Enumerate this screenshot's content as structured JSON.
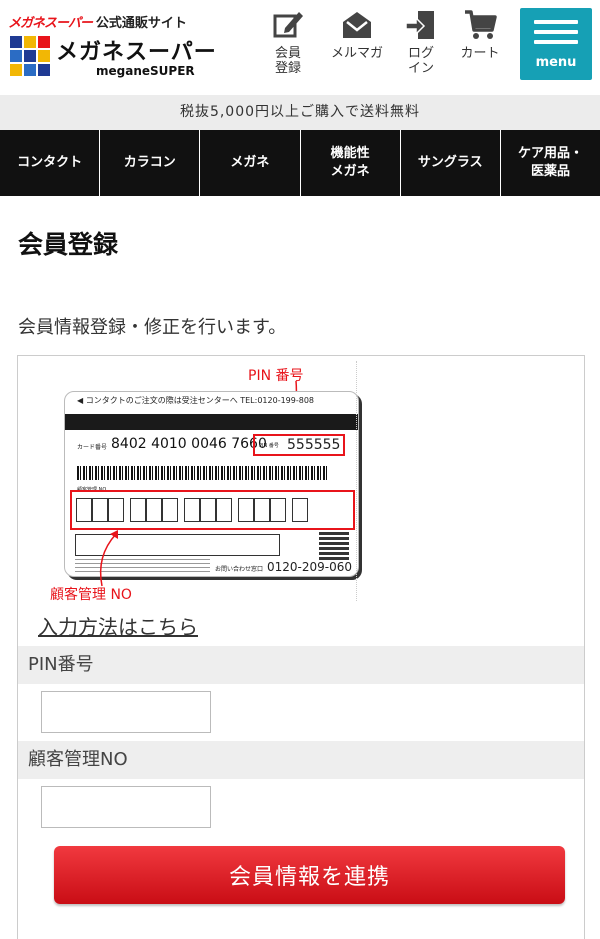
{
  "header": {
    "logo_brand": "メガネスーパー",
    "logo_catch": "公式通販サイト",
    "logo_name": "メガネスーパー",
    "logo_sub": "meganeSUPER",
    "nav": [
      {
        "label": "会員\n登録",
        "label1": "会員",
        "label2": "登録",
        "icon": "edit-icon"
      },
      {
        "label": "メルマガ",
        "icon": "mail-icon"
      },
      {
        "label1": "ログ",
        "label2": "イン",
        "icon": "login-icon"
      },
      {
        "label": "カート",
        "icon": "cart-icon"
      }
    ],
    "menu_label": "menu"
  },
  "shipping_notice": "税抜5,000円以上ご購入で送料無料",
  "categories": [
    {
      "label1": "コンタクト",
      "label2": ""
    },
    {
      "label1": "カラコン",
      "label2": ""
    },
    {
      "label1": "メガネ",
      "label2": ""
    },
    {
      "label1": "機能性",
      "label2": "メガネ"
    },
    {
      "label1": "サングラス",
      "label2": ""
    },
    {
      "label1": "ケア用品・",
      "label2": "医薬品"
    }
  ],
  "page": {
    "title": "会員登録",
    "intro": "会員情報登録・修正を行います。"
  },
  "card_image": {
    "pin_callout": "PIN 番号",
    "customer_no_callout": "顧客管理 NO",
    "top_text": "◀  コンタクトのご注文の際は受注センターへ TEL:0120-199-808",
    "card_number_label": "カード番号",
    "card_number": "8402 4010 0046 7660",
    "pin_small_label": "PIN 番号",
    "pin_value": "555555",
    "customer_no_label": "顧客管理 NO",
    "tel_label": "お問い合わせ窓口",
    "tel": "0120-209-060"
  },
  "form": {
    "howto_link": "入力方法はこちら",
    "pin_label": "PIN番号",
    "pin_value": "",
    "customer_no_label": "顧客管理NO",
    "customer_no_value": "",
    "submit_label": "会員情報を連携"
  },
  "colors": {
    "accent_red": "#e8141b",
    "menu_teal": "#16a0b5",
    "nav_black": "#111111"
  }
}
